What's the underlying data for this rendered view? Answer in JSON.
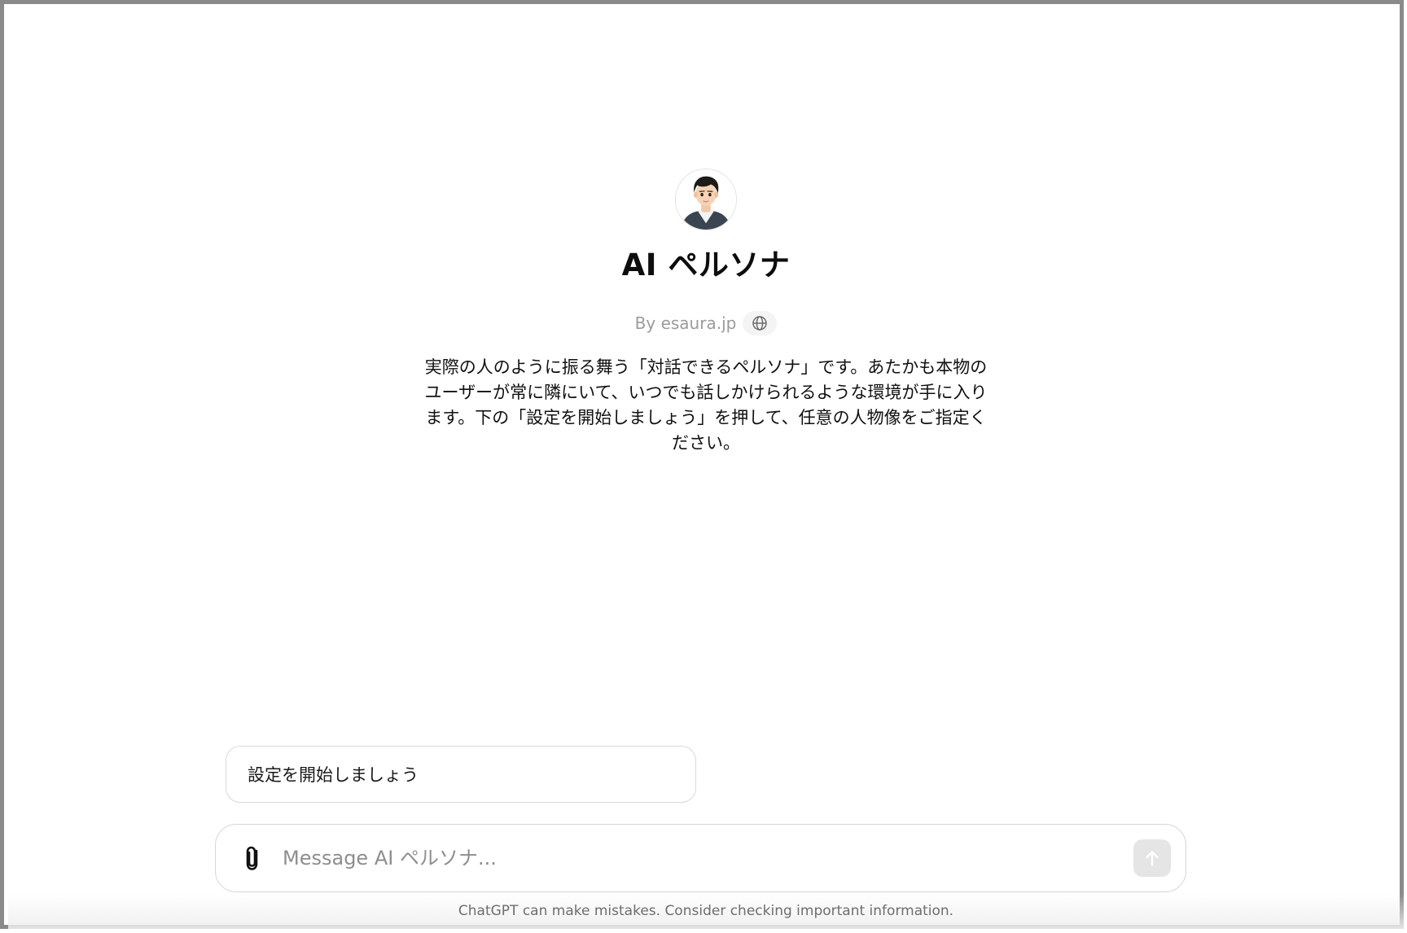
{
  "gpt": {
    "name": "AI ペルソナ",
    "byline": "By esaura.jp",
    "description": "実際の人のように振る舞う「対話できるペルソナ」です。あたかも本物のユーザーが常に隣にいて、いつでも話しかけられるような環境が手に入ります。下の「設定を開始しましょう」を押して、任意の人物像をご指定ください。"
  },
  "conversation_starters": [
    {
      "label": "設定を開始しましょう"
    }
  ],
  "composer": {
    "placeholder": "Message AI ペルソナ...",
    "attach_icon": "paperclip-icon",
    "send_icon": "arrow-up-icon"
  },
  "footer": {
    "disclaimer": "ChatGPT can make mistakes. Consider checking important information."
  },
  "colors": {
    "frame_border": "#8a8a8a",
    "muted_text": "#9b9b9b",
    "send_button_bg": "#e5e5e5"
  }
}
